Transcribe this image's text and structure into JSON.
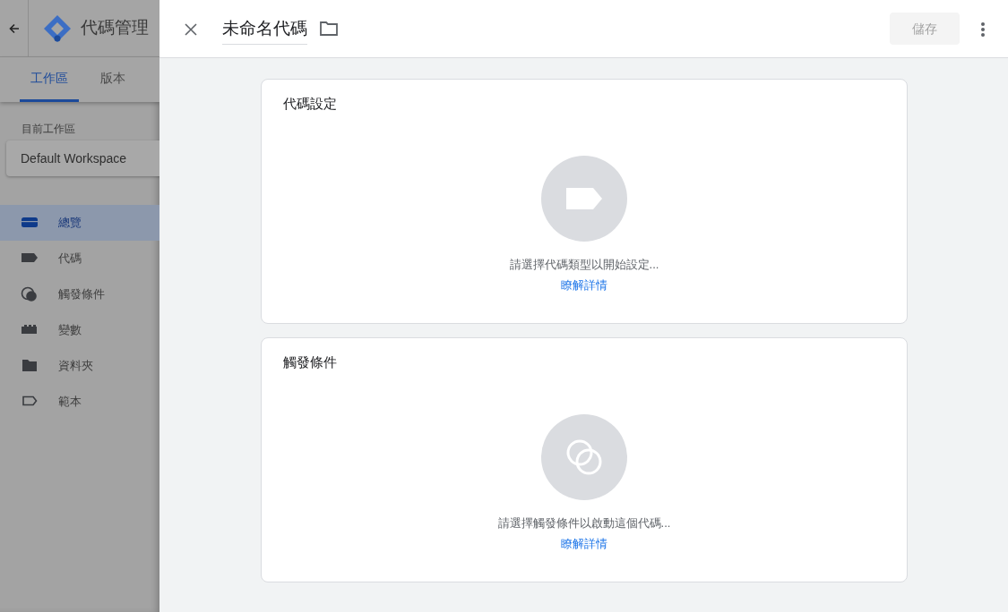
{
  "app": {
    "title": "代碼管理",
    "tabs": [
      {
        "label": "工作區",
        "selected": true
      },
      {
        "label": "版本",
        "selected": false
      }
    ],
    "workspace": {
      "label": "目前工作區",
      "name": "Default Workspace"
    },
    "nav": [
      {
        "label": "總覽",
        "kind": "overview",
        "selected": true
      },
      {
        "label": "代碼",
        "kind": "tag",
        "selected": false
      },
      {
        "label": "觸發條件",
        "kind": "trigger",
        "selected": false
      },
      {
        "label": "變數",
        "kind": "variable",
        "selected": false
      },
      {
        "label": "資料夾",
        "kind": "folder",
        "selected": false
      },
      {
        "label": "範本",
        "kind": "template",
        "selected": false
      }
    ]
  },
  "editor": {
    "title": "未命名代碼",
    "save": {
      "label": "儲存",
      "disabled": true
    },
    "sections": [
      {
        "kind": "tag",
        "title": "代碼設定",
        "prompt": "請選擇代碼類型以開始設定...",
        "link": "瞭解詳情"
      },
      {
        "kind": "trigger",
        "title": "觸發條件",
        "prompt": "請選擇觸發條件以啟動這個代碼...",
        "link": "瞭解詳情"
      }
    ]
  }
}
